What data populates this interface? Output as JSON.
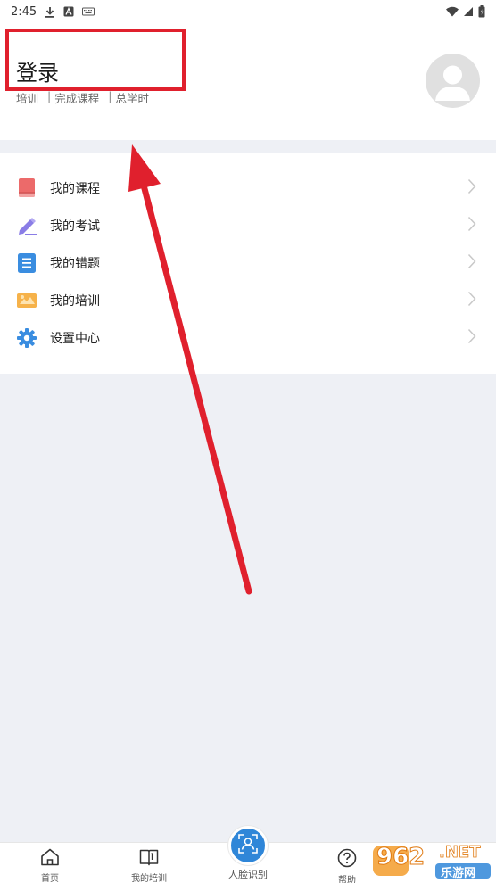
{
  "status_bar": {
    "time": "2:45"
  },
  "header": {
    "title": "登录",
    "stats": [
      "培训",
      "完成课程",
      "总学时"
    ],
    "separator": "|"
  },
  "menu": {
    "items": [
      {
        "label": "我的课程",
        "icon": "book-icon",
        "color": "#e8585a"
      },
      {
        "label": "我的考试",
        "icon": "pencil-icon",
        "color": "#8a7de6"
      },
      {
        "label": "我的错题",
        "icon": "list-icon",
        "color": "#3a8de0"
      },
      {
        "label": "我的培训",
        "icon": "training-icon",
        "color": "#f4a93a"
      },
      {
        "label": "设置中心",
        "icon": "gear-icon",
        "color": "#3a8de0"
      }
    ]
  },
  "tabbar": {
    "tabs": [
      {
        "label": "首页",
        "icon": "home-icon"
      },
      {
        "label": "我的培训",
        "icon": "open-book-icon"
      },
      {
        "label": "人脸识别",
        "icon": "face-scan-icon"
      },
      {
        "label": "帮助",
        "icon": "help-icon"
      }
    ]
  },
  "watermark": {
    "digits": "962",
    "suffix": ".NET",
    "brand": "乐游网"
  },
  "colors": {
    "accent": "#2f86d8",
    "annotation": "#e0202d",
    "background": "#eef0f5"
  }
}
